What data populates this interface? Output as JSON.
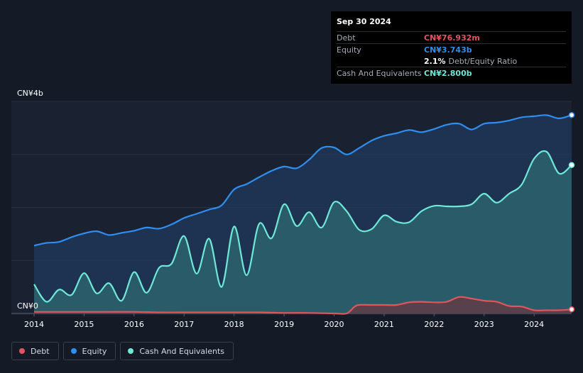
{
  "tooltip": {
    "date": "Sep 30 2024",
    "debt_label": "Debt",
    "debt_value": "CN¥76.932m",
    "equity_label": "Equity",
    "equity_value": "CN¥3.743b",
    "ratio_value": "2.1%",
    "ratio_label": "Debt/Equity Ratio",
    "cash_label": "Cash And Equivalents",
    "cash_value": "CN¥2.800b"
  },
  "legend": [
    {
      "label": "Debt",
      "color": "#e4545c"
    },
    {
      "label": "Equity",
      "color": "#2f8ef0"
    },
    {
      "label": "Cash And Equivalents",
      "color": "#6ee8d8"
    }
  ],
  "chart_data": {
    "type": "area",
    "y_unit": "CN¥ billions",
    "ylim": [
      0,
      4
    ],
    "y_tick_labels": [
      "CN¥0",
      "CN¥4b"
    ],
    "x_ticks": [
      "2014",
      "2015",
      "2016",
      "2017",
      "2018",
      "2019",
      "2020",
      "2021",
      "2022",
      "2023",
      "2024"
    ],
    "xlim": [
      2014.0,
      2024.75
    ],
    "grid": true,
    "legend_position": "bottom-left",
    "series": [
      {
        "name": "Equity",
        "color": "#2f8ef0",
        "x": [
          2014.0,
          2014.25,
          2014.5,
          2014.75,
          2015.0,
          2015.25,
          2015.5,
          2015.75,
          2016.0,
          2016.25,
          2016.5,
          2016.75,
          2017.0,
          2017.25,
          2017.5,
          2017.75,
          2018.0,
          2018.25,
          2018.5,
          2018.75,
          2019.0,
          2019.25,
          2019.5,
          2019.75,
          2020.0,
          2020.25,
          2020.5,
          2020.75,
          2021.0,
          2021.25,
          2021.5,
          2021.75,
          2022.0,
          2022.25,
          2022.5,
          2022.75,
          2023.0,
          2023.25,
          2023.5,
          2023.75,
          2024.0,
          2024.25,
          2024.5,
          2024.75
        ],
        "values": [
          1.28,
          1.33,
          1.35,
          1.44,
          1.51,
          1.55,
          1.48,
          1.52,
          1.56,
          1.62,
          1.6,
          1.68,
          1.8,
          1.88,
          1.96,
          2.04,
          2.34,
          2.44,
          2.57,
          2.69,
          2.77,
          2.74,
          2.9,
          3.12,
          3.13,
          3.0,
          3.12,
          3.26,
          3.35,
          3.4,
          3.46,
          3.42,
          3.48,
          3.56,
          3.58,
          3.47,
          3.58,
          3.6,
          3.64,
          3.7,
          3.72,
          3.74,
          3.68,
          3.743
        ]
      },
      {
        "name": "Cash And Equivalents",
        "color": "#6ee8d8",
        "x": [
          2014.0,
          2014.25,
          2014.5,
          2014.75,
          2015.0,
          2015.25,
          2015.5,
          2015.75,
          2016.0,
          2016.25,
          2016.5,
          2016.75,
          2017.0,
          2017.25,
          2017.5,
          2017.75,
          2018.0,
          2018.25,
          2018.5,
          2018.75,
          2019.0,
          2019.25,
          2019.5,
          2019.75,
          2020.0,
          2020.25,
          2020.5,
          2020.75,
          2021.0,
          2021.25,
          2021.5,
          2021.75,
          2022.0,
          2022.25,
          2022.5,
          2022.75,
          2023.0,
          2023.25,
          2023.5,
          2023.75,
          2024.0,
          2024.25,
          2024.5,
          2024.75
        ],
        "values": [
          0.55,
          0.22,
          0.45,
          0.35,
          0.76,
          0.38,
          0.57,
          0.24,
          0.78,
          0.39,
          0.86,
          0.94,
          1.46,
          0.75,
          1.41,
          0.5,
          1.64,
          0.72,
          1.69,
          1.42,
          2.06,
          1.65,
          1.91,
          1.62,
          2.1,
          1.93,
          1.58,
          1.59,
          1.85,
          1.73,
          1.72,
          1.93,
          2.03,
          2.02,
          2.02,
          2.06,
          2.26,
          2.09,
          2.26,
          2.43,
          2.92,
          3.05,
          2.64,
          2.8
        ]
      },
      {
        "name": "Debt",
        "color": "#e4545c",
        "x": [
          2014.0,
          2014.5,
          2015.0,
          2015.5,
          2016.0,
          2016.5,
          2017.0,
          2017.5,
          2018.0,
          2018.5,
          2019.0,
          2019.5,
          2020.0,
          2020.25,
          2020.4,
          2020.5,
          2020.75,
          2021.0,
          2021.25,
          2021.5,
          2021.75,
          2022.0,
          2022.25,
          2022.5,
          2022.75,
          2023.0,
          2023.25,
          2023.5,
          2023.75,
          2024.0,
          2024.25,
          2024.5,
          2024.75
        ],
        "values": [
          0.03,
          0.03,
          0.03,
          0.03,
          0.03,
          0.02,
          0.02,
          0.02,
          0.02,
          0.02,
          0.01,
          0.01,
          0.0,
          0.0,
          0.12,
          0.16,
          0.16,
          0.16,
          0.16,
          0.21,
          0.22,
          0.21,
          0.22,
          0.31,
          0.28,
          0.24,
          0.22,
          0.14,
          0.13,
          0.06,
          0.06,
          0.06,
          0.076932
        ]
      }
    ]
  }
}
